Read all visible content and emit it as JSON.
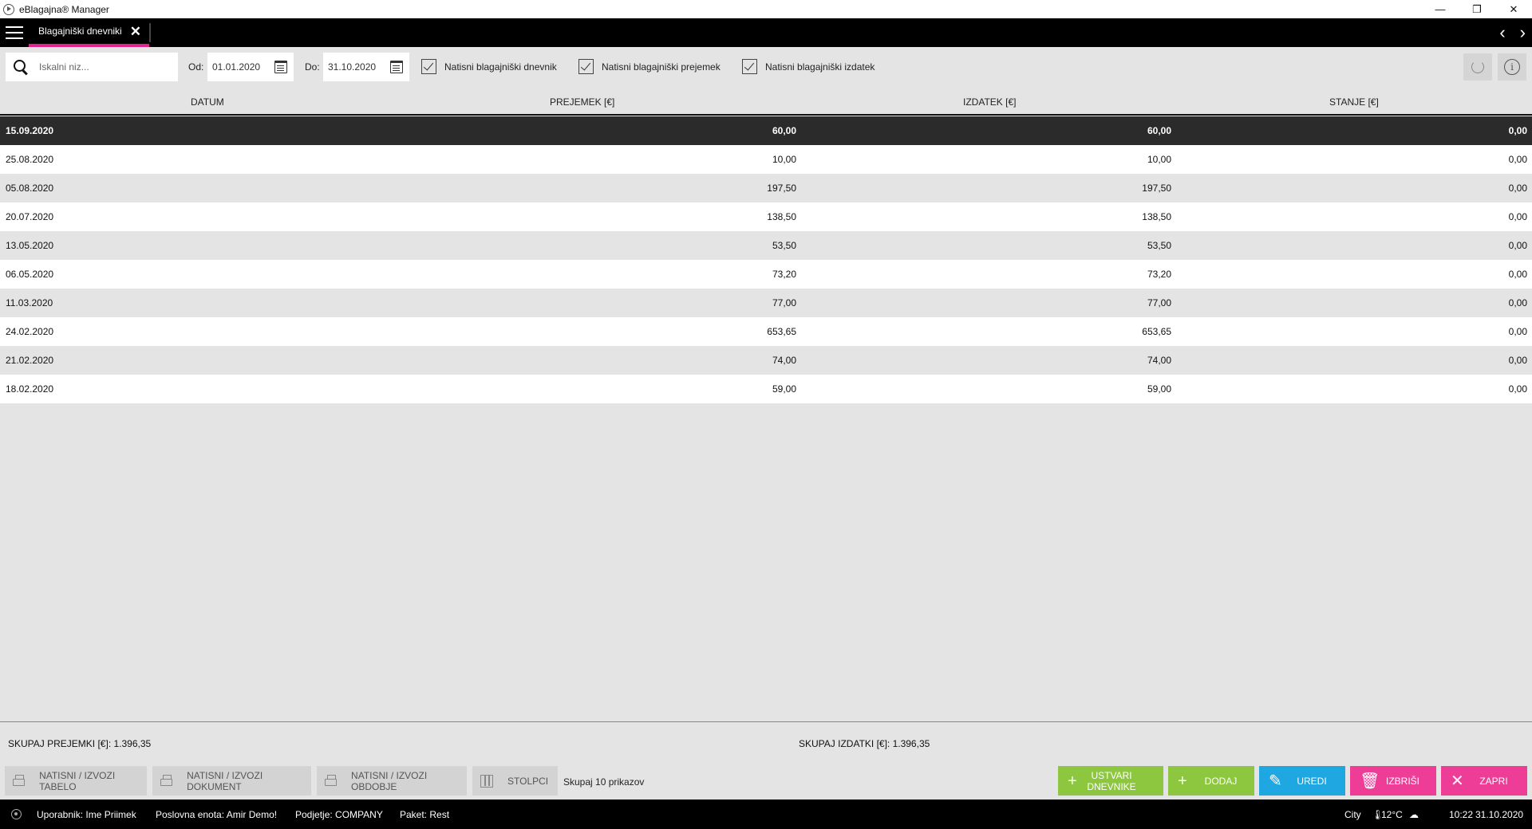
{
  "window": {
    "title": "eBlagajna® Manager",
    "minimize": "—",
    "restore": "❐",
    "close": "✕"
  },
  "tabs": [
    {
      "label": "Blagajniški dnevniki",
      "close": "✕"
    }
  ],
  "nav": {
    "back": "‹",
    "forward": "›"
  },
  "filters": {
    "search_placeholder": "Iskalni niz...",
    "from_label": "Od:",
    "from_value": "01.01.2020",
    "to_label": "Do:",
    "to_value": "31.10.2020",
    "checkboxes": [
      {
        "label": "Natisni blagajniški dnevnik",
        "checked": true
      },
      {
        "label": "Natisni blagajniški prejemek",
        "checked": true
      },
      {
        "label": "Natisni blagajniški izdatek",
        "checked": true
      }
    ],
    "info_icon": "i"
  },
  "table": {
    "columns": [
      "DATUM",
      "PREJEMEK [€]",
      "IZDATEK [€]",
      "STANJE [€]"
    ],
    "rows": [
      {
        "datum": "15.09.2020",
        "prejemek": "60,00",
        "izdatek": "60,00",
        "stanje": "0,00"
      },
      {
        "datum": "25.08.2020",
        "prejemek": "10,00",
        "izdatek": "10,00",
        "stanje": "0,00"
      },
      {
        "datum": "05.08.2020",
        "prejemek": "197,50",
        "izdatek": "197,50",
        "stanje": "0,00"
      },
      {
        "datum": "20.07.2020",
        "prejemek": "138,50",
        "izdatek": "138,50",
        "stanje": "0,00"
      },
      {
        "datum": "13.05.2020",
        "prejemek": "53,50",
        "izdatek": "53,50",
        "stanje": "0,00"
      },
      {
        "datum": "06.05.2020",
        "prejemek": "73,20",
        "izdatek": "73,20",
        "stanje": "0,00"
      },
      {
        "datum": "11.03.2020",
        "prejemek": "77,00",
        "izdatek": "77,00",
        "stanje": "0,00"
      },
      {
        "datum": "24.02.2020",
        "prejemek": "653,65",
        "izdatek": "653,65",
        "stanje": "0,00"
      },
      {
        "datum": "21.02.2020",
        "prejemek": "74,00",
        "izdatek": "74,00",
        "stanje": "0,00"
      },
      {
        "datum": "18.02.2020",
        "prejemek": "59,00",
        "izdatek": "59,00",
        "stanje": "0,00"
      }
    ],
    "selected_index": 0
  },
  "totals": {
    "prejemki": "SKUPAJ PREJEMKI [€]: 1.396,35",
    "izdatki": "SKUPAJ IZDATKI [€]: 1.396,35"
  },
  "actions": {
    "print_table": "NATISNI / IZVOZI TABELO",
    "print_document": "NATISNI / IZVOZI DOKUMENT",
    "print_period": "NATISNI / IZVOZI OBDOBJE",
    "columns": "STOLPCI",
    "summary": "Skupaj 10 prikazov",
    "create": "USTVARI DNEVNIKE",
    "add": "DODAJ",
    "edit": "UREDI",
    "delete": "IZBRIŠI",
    "close": "ZAPRI"
  },
  "action_colors": {
    "create": "#8dc63f",
    "add": "#8dc63f",
    "edit": "#1fa7e1",
    "delete": "#ee3d96",
    "close": "#ee3d96"
  },
  "status": {
    "user": "Uporabnik: Ime Priimek",
    "unit": "Poslovna enota: Amir Demo!",
    "company": "Podjetje: COMPANY",
    "package": "Paket: Rest",
    "city": "City",
    "temp": "12°C",
    "time": "10:22",
    "date": "31.10.2020"
  }
}
